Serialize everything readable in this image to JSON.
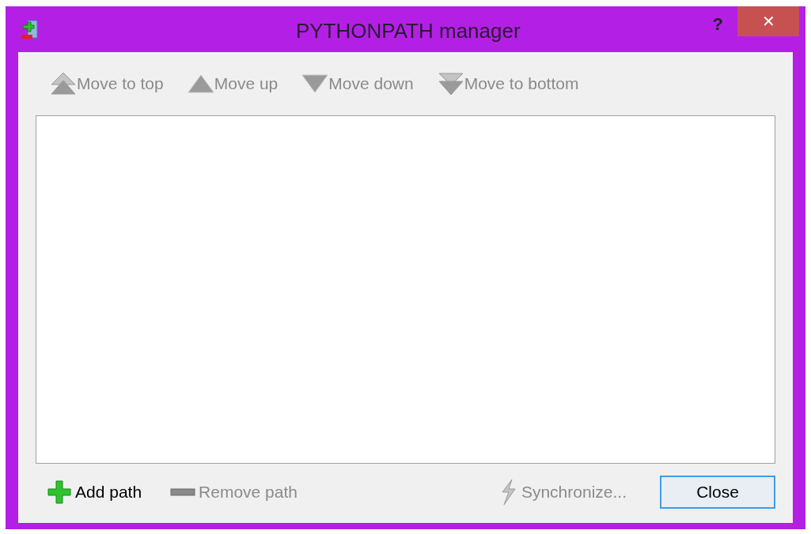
{
  "window": {
    "title": "PYTHONPATH manager",
    "help": "?",
    "close": "✕"
  },
  "toolbar": [
    {
      "kind": "top",
      "label": "Move to top",
      "disabled": true
    },
    {
      "kind": "up",
      "label": "Move up",
      "disabled": true
    },
    {
      "kind": "down",
      "label": "Move down",
      "disabled": true
    },
    {
      "kind": "bottom",
      "label": "Move to bottom",
      "disabled": true
    }
  ],
  "actions": [
    {
      "kind": "add",
      "label": "Add path",
      "disabled": false
    },
    {
      "kind": "remove",
      "label": "Remove path",
      "disabled": true
    },
    {
      "kind": "sync",
      "label": "Synchronize...",
      "disabled": true
    }
  ],
  "close_button": {
    "label": "Close",
    "focused": true
  }
}
